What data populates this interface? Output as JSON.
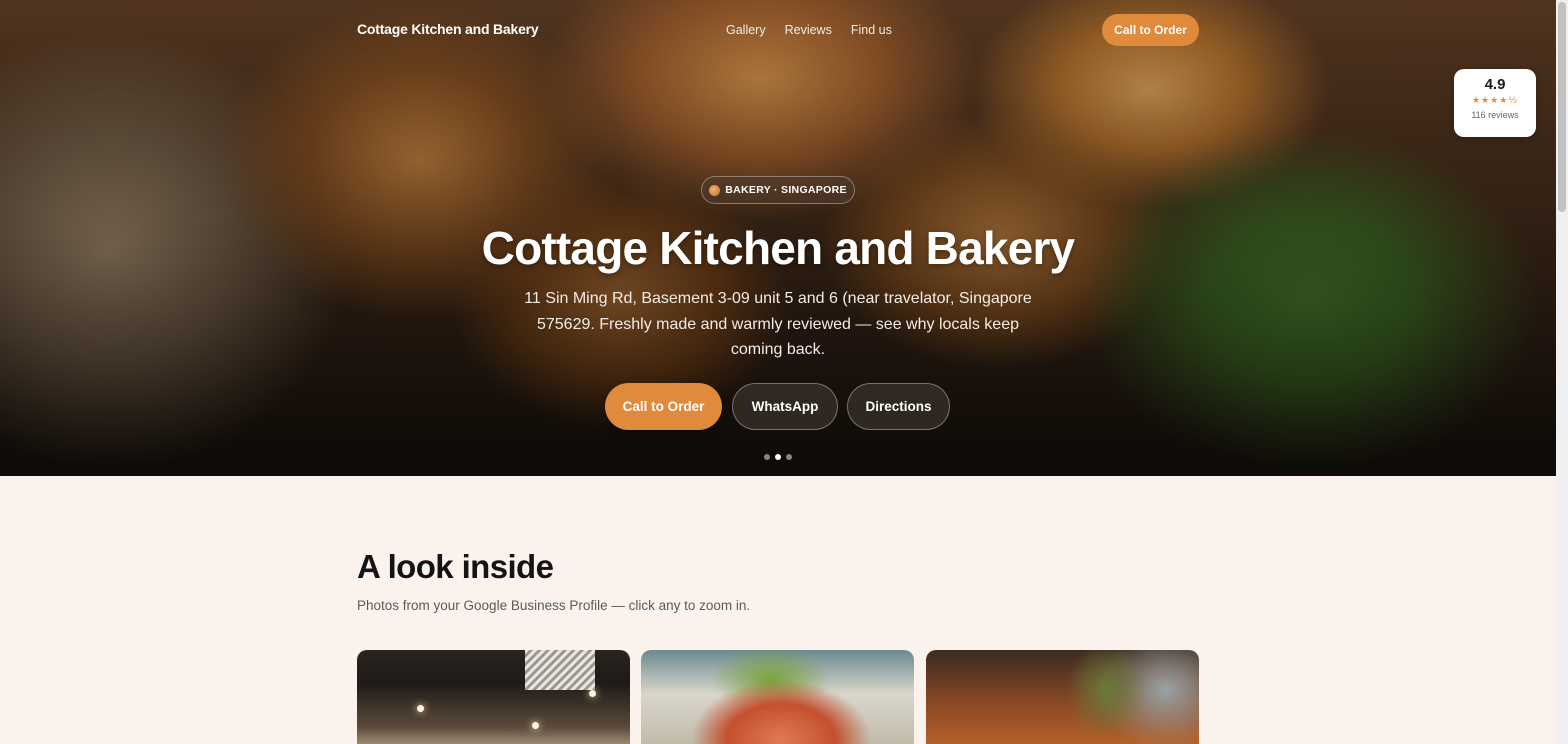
{
  "header": {
    "brand": "Cottage Kitchen and Bakery",
    "nav": [
      {
        "label": "Gallery"
      },
      {
        "label": "Reviews"
      },
      {
        "label": "Find us"
      }
    ],
    "cta_label": "Call to Order"
  },
  "rating": {
    "score": "4.9",
    "stars": "★★★★½",
    "count": "116 reviews"
  },
  "hero": {
    "badge": "BAKERY · SINGAPORE",
    "title": "Cottage Kitchen and Bakery",
    "subtitle": "11 Sin Ming Rd, Basement 3-09 unit 5 and 6 (near travelator, Singapore 575629. Freshly made and warmly reviewed — see why locals keep coming back.",
    "buttons": {
      "call": "Call to Order",
      "whatsapp": "WhatsApp",
      "directions": "Directions"
    },
    "carousel": {
      "count": 3,
      "active_index": 1
    }
  },
  "gallery": {
    "title": "A look inside",
    "subtitle": "Photos from your Google Business Profile — click any to zoom in."
  },
  "colors": {
    "accent": "#e08a3c",
    "page_bg": "#fbf2ee",
    "heading": "#141414"
  }
}
